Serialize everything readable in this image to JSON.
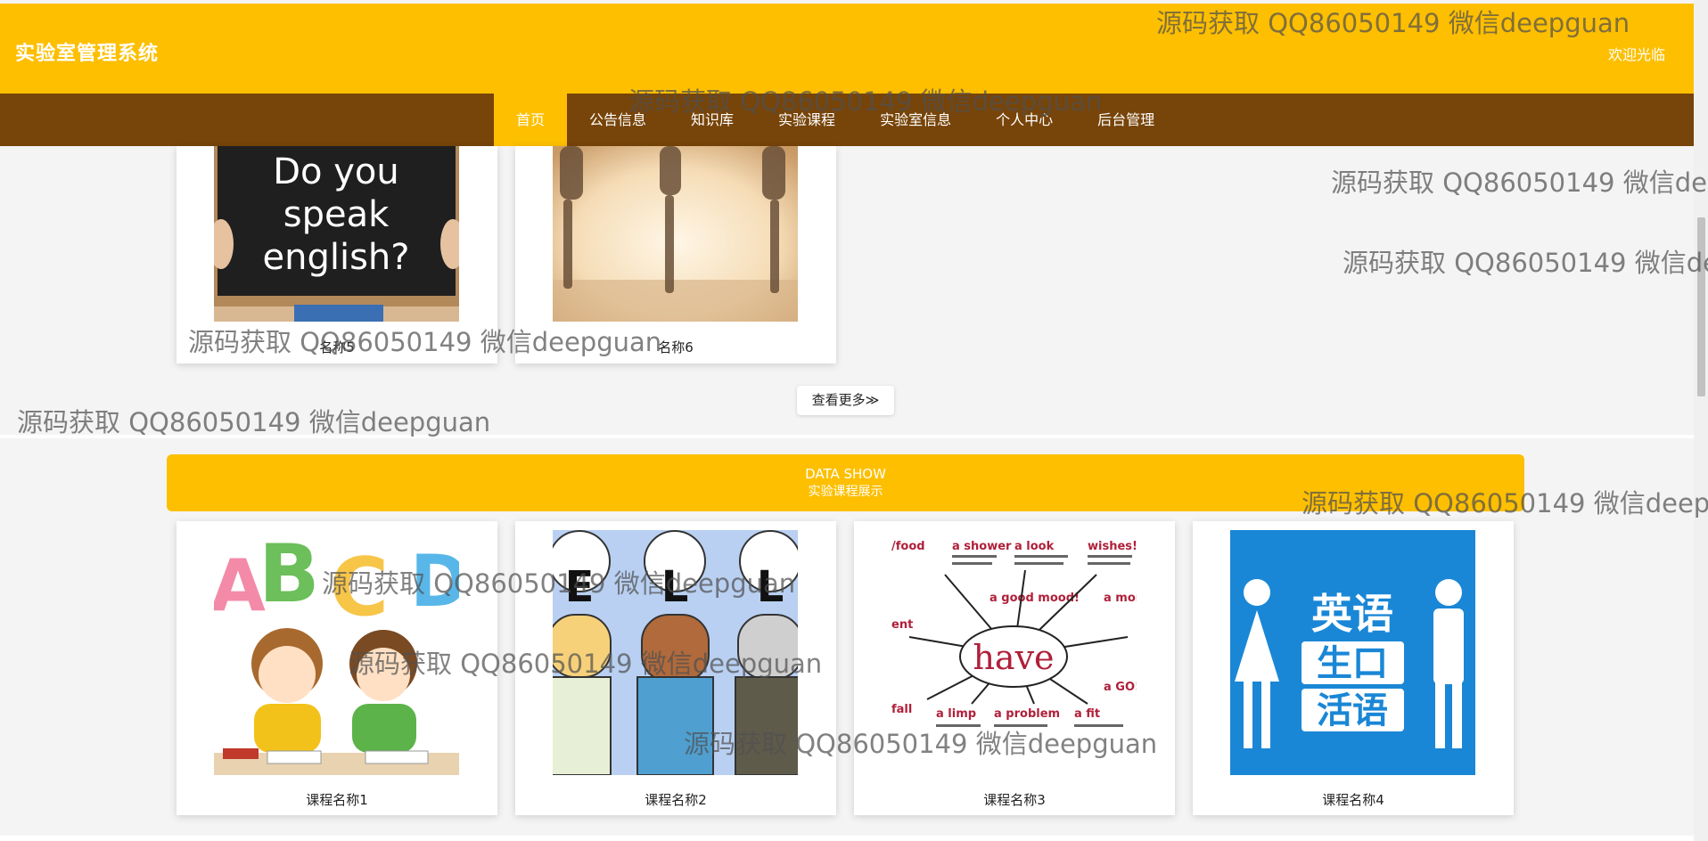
{
  "header": {
    "site_title": "实验室管理系统",
    "welcome": "欢迎光临"
  },
  "nav": {
    "items": [
      {
        "label": "首页",
        "active": true
      },
      {
        "label": "公告信息",
        "active": false
      },
      {
        "label": "知识库",
        "active": false
      },
      {
        "label": "实验课程",
        "active": false
      },
      {
        "label": "实验室信息",
        "active": false
      },
      {
        "label": "个人中心",
        "active": false
      },
      {
        "label": "后台管理",
        "active": false
      }
    ]
  },
  "knowledge": {
    "cards": [
      {
        "caption": "名称5",
        "image": "chalkboard-do-you-speak-english"
      },
      {
        "caption": "名称6",
        "image": "yoga-silhouettes"
      }
    ],
    "more_label": "查看更多≫"
  },
  "data_show": {
    "title_en": "DATA SHOW",
    "title_cn": "实验课程展示"
  },
  "courses": {
    "cards": [
      {
        "caption": "课程名称1",
        "image": "abc-kids-reading"
      },
      {
        "caption": "课程名称2",
        "image": "ell-cartoon-characters"
      },
      {
        "caption": "课程名称3",
        "image": "have-mindmap"
      },
      {
        "caption": "课程名称4",
        "image": "english-spoken-sign"
      }
    ]
  },
  "watermark_text": "源码获取 QQ86050149 微信deepguan",
  "images": {
    "chalkboard_line1": "Do you",
    "chalkboard_line2": "speak",
    "chalkboard_line3": "english?",
    "abc_letters": [
      "A",
      "B",
      "C",
      "D"
    ],
    "ell_letters": [
      "E",
      "L",
      "L"
    ],
    "have_word": "have",
    "have_labels": [
      "a shower",
      "a look",
      "wishes!",
      "a good mood!",
      "a mon",
      "a limp",
      "a problem",
      "a fit",
      "a GO!",
      "/food",
      "fall",
      "ent"
    ],
    "english_sign_lines": [
      "英语",
      "生口",
      "活语"
    ]
  },
  "colors": {
    "header_yellow": "#fdbf00",
    "nav_brown": "#774409",
    "active_tab": "#fdbf00"
  }
}
